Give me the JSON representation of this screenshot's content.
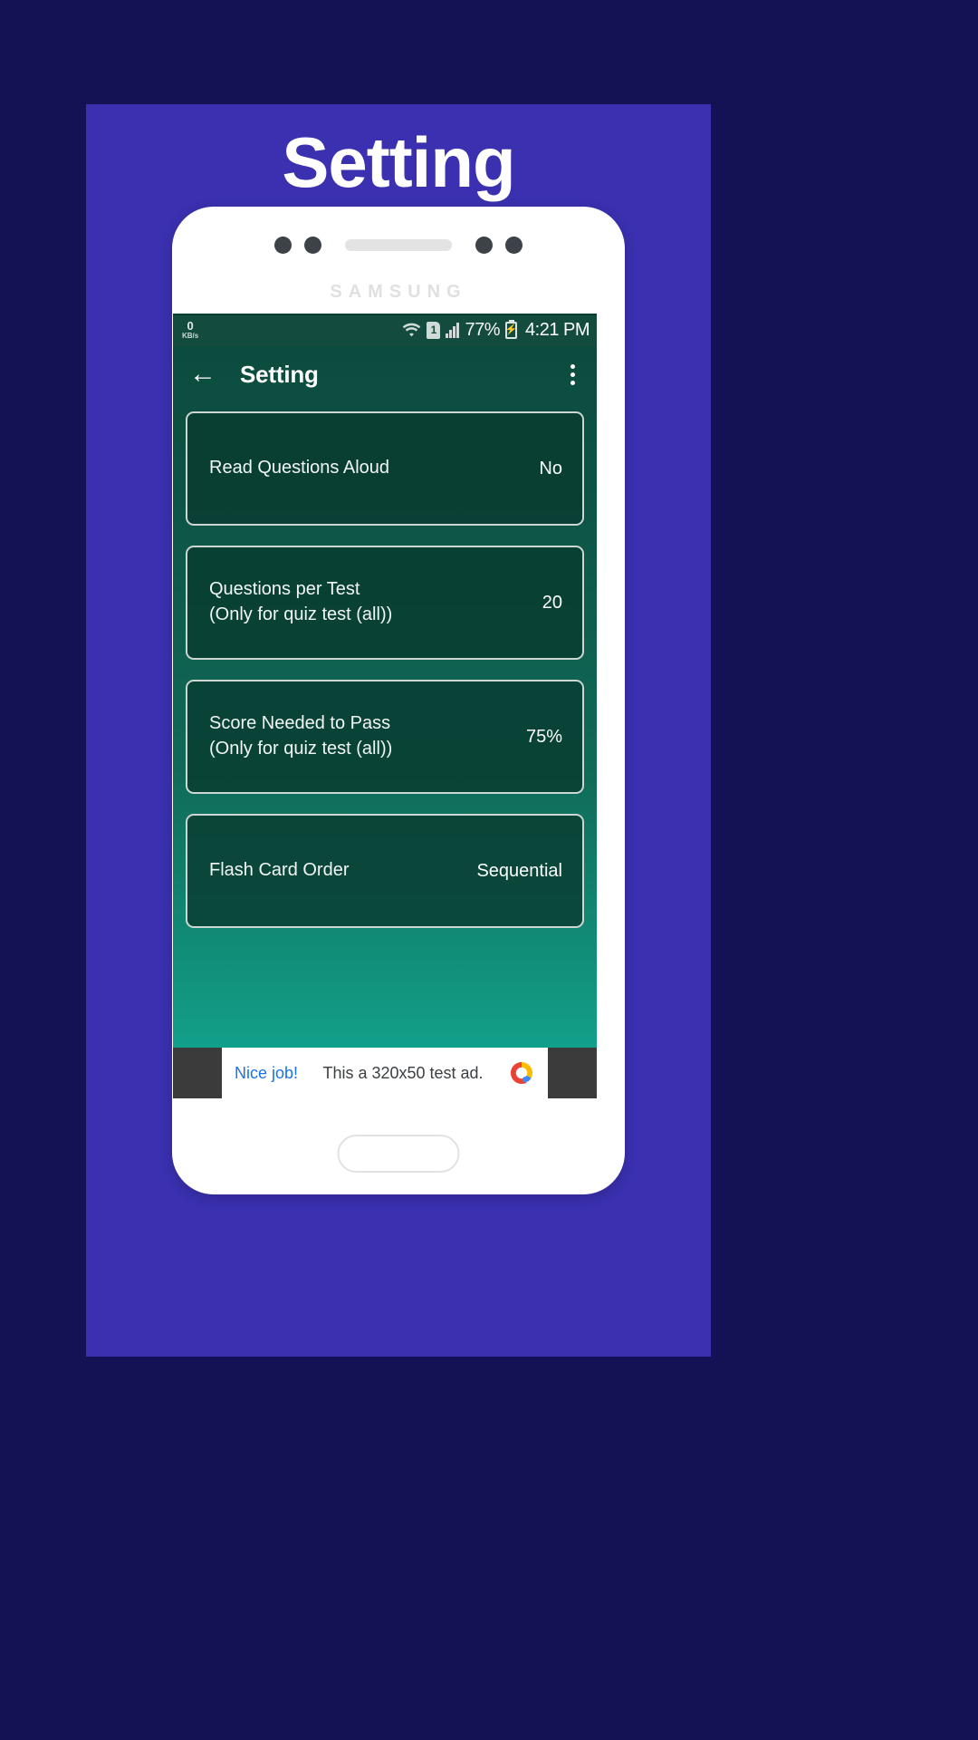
{
  "promo": {
    "title": "Setting",
    "background_color": "#3A30B0",
    "outer_background_color": "#131255"
  },
  "phone": {
    "brand": "SAMSUNG"
  },
  "status_bar": {
    "net_speed_value": "0",
    "net_speed_unit": "KB/s",
    "wifi_icon": "wifi-icon",
    "sim_label": "1",
    "signal_icon": "signal-bars-icon",
    "battery_percent": "77%",
    "battery_icon": "battery-charging-icon",
    "battery_bolt": "⚡",
    "time": "4:21 PM"
  },
  "toolbar": {
    "back_icon": "←",
    "title": "Setting",
    "overflow_icon": "more-vertical-icon"
  },
  "settings": {
    "items": [
      {
        "label": "Read Questions Aloud",
        "value": "No"
      },
      {
        "label": "Questions per Test\n(Only for quiz test (all))",
        "value": "20"
      },
      {
        "label": "Score Needed to Pass\n(Only for quiz test (all))",
        "value": "75%"
      },
      {
        "label": "Flash Card Order",
        "value": "Sequential"
      }
    ]
  },
  "ad": {
    "cta": "Nice job!",
    "text": "This a 320x50 test ad.",
    "logo": "admob-logo"
  },
  "colors": {
    "screen_top": "#0b4a3c",
    "screen_bottom": "#12a08a",
    "status_bar": "#134c3f",
    "card_border": "#cdd6d3",
    "ad_link": "#1a73e8"
  }
}
